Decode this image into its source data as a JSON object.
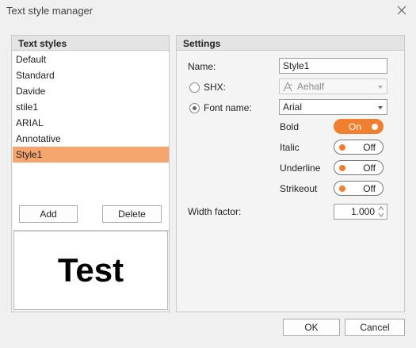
{
  "window": {
    "title": "Text style manager"
  },
  "styles_panel": {
    "header": "Text styles",
    "items": [
      "Default",
      "Standard",
      "Davide",
      "stile1",
      "ARIAL",
      "Annotative",
      "Style1"
    ],
    "selected_index": 6,
    "add_label": "Add",
    "delete_label": "Delete",
    "preview_text": "Test"
  },
  "settings": {
    "header": "Settings",
    "name_label": "Name:",
    "name_value": "Style1",
    "shx_label": "SHX:",
    "shx_value": "Aehalf",
    "font_name_label": "Font name:",
    "font_name_value": "Arial",
    "font_mode": "font_name",
    "bold_label": "Bold",
    "bold_state": "On",
    "italic_label": "Italic",
    "italic_state": "Off",
    "underline_label": "Underline",
    "underline_state": "Off",
    "strikeout_label": "Strikeout",
    "strikeout_state": "Off",
    "width_factor_label": "Width factor:",
    "width_factor_value": "1.000"
  },
  "footer": {
    "ok_label": "OK",
    "cancel_label": "Cancel"
  },
  "colors": {
    "accent": "#f07f2f",
    "selection": "#f7a56e"
  }
}
